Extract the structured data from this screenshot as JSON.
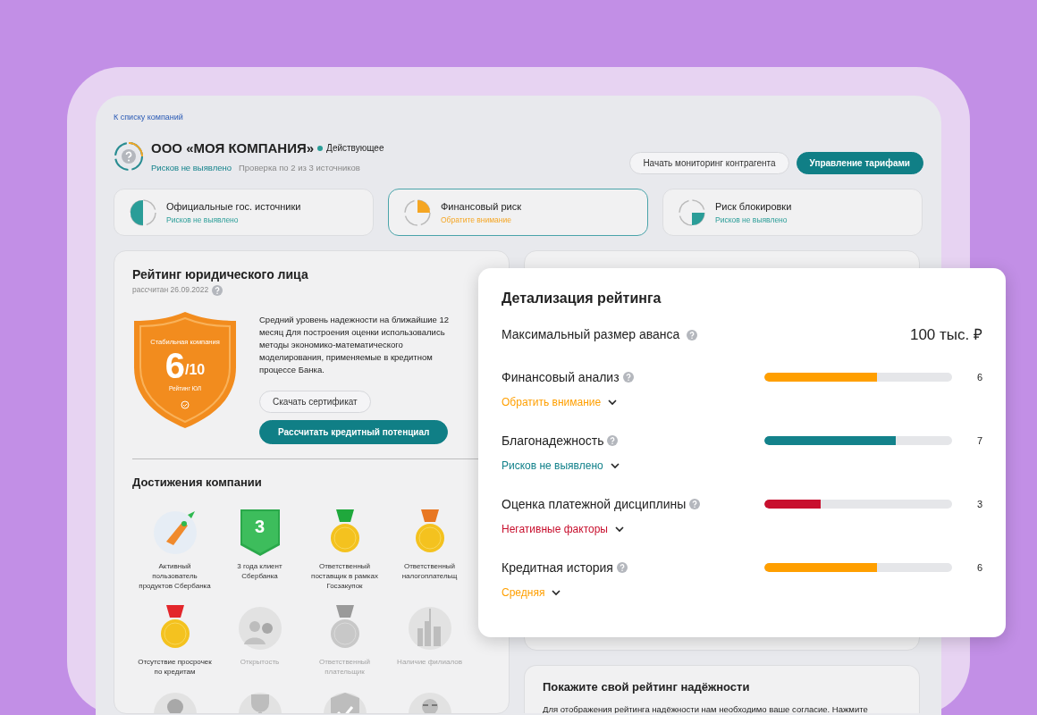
{
  "back_link": "К списку компаний",
  "company": {
    "name": "ООО «МОЯ КОМПАНИЯ»",
    "status": "Действующее",
    "risk_summary": "Рисков не выявлено",
    "check_info": "Проверка по 2 из 3 источников"
  },
  "header_buttons": [
    {
      "label": "Начать мониторинг контрагента",
      "kind": "outline"
    },
    {
      "label": "Управление тарифами",
      "kind": "primary"
    }
  ],
  "risk_cards": [
    {
      "title": "Официальные гос. источники",
      "status": "Рисков не выявлено",
      "kind": "half",
      "color": "#2a9d98",
      "selected": false
    },
    {
      "title": "Финансовый риск",
      "status": "Обратите внимание",
      "kind": "quarter-top",
      "color": "#f5a623",
      "selected": true
    },
    {
      "title": "Риск блокировки",
      "status": "Рисков не выявлено",
      "kind": "quarter-bottom",
      "color": "#2a9d98",
      "selected": false
    }
  ],
  "rating": {
    "title": "Рейтинг юридического лица",
    "date": "рассчитан 26.09.2022",
    "shield": {
      "label": "Стабильная компания",
      "score": "6",
      "scale": "/10",
      "caption": "Рейтинг ЮЛ"
    },
    "description": "Средний уровень надежности на ближайшие 12 месяц Для построения оценки использовались методы экономико-математического моделирования, применяемые в кредитном процессе Банка.",
    "buttons": [
      {
        "label": "Скачать сертификат",
        "kind": "outline"
      },
      {
        "label": "Рассчитать кредитный потенциал",
        "kind": "primary"
      }
    ]
  },
  "achievements": {
    "title": "Достижения компании",
    "items": [
      {
        "kind": "rocket",
        "label": "Активный пользователь продуктов Сбербанка",
        "earned": true
      },
      {
        "kind": "years",
        "badge_text": "3",
        "label": "3 года клиент Сбербанка",
        "earned": true
      },
      {
        "kind": "medal",
        "color": "#1fa83c",
        "label": "Ответственный поставщик в рамках Госзакупок",
        "earned": true
      },
      {
        "kind": "medal",
        "color": "#e87722",
        "label": "Ответственный налогоплательщ",
        "earned": true
      },
      {
        "kind": "medal",
        "color": "#e3262b",
        "label": "Отсутствие просрочек по кредитам",
        "earned": true
      },
      {
        "kind": "people",
        "label": "Открытость",
        "earned": false
      },
      {
        "kind": "medal",
        "color": "#9a9a9a",
        "label": "Ответственный плательщик",
        "earned": false
      },
      {
        "kind": "city",
        "label": "Наличие филиалов",
        "earned": false
      },
      {
        "kind": "person",
        "earned": false
      },
      {
        "kind": "trophy",
        "earned": false
      },
      {
        "kind": "shield",
        "earned": false
      },
      {
        "kind": "person-glasses",
        "earned": false
      }
    ]
  },
  "consent": {
    "title": "Покажите свой рейтинг надёжности",
    "text": "Для отображения рейтинга надёжности нам необходимо ваше согласие. Нажмите"
  },
  "detail": {
    "title": "Детализация рейтинга",
    "advance": {
      "label": "Максимальный размер аванса",
      "value": "100 тыс. ₽"
    },
    "factors": [
      {
        "label": "Финансовый анализ",
        "level": 0.6,
        "score": "6",
        "status": "Обратить внимание",
        "color": "#ff9f00"
      },
      {
        "label": "Благонадежность",
        "level": 0.7,
        "score": "7",
        "status": "Рисков не выявлено",
        "color": "#13828b"
      },
      {
        "label": "Оценка платежной дисциплины",
        "level": 0.3,
        "score": "3",
        "status": "Негативные факторы",
        "color": "#c8102e"
      },
      {
        "label": "Кредитная история",
        "level": 0.6,
        "score": "6",
        "status": "Средняя",
        "color": "#ff9f00"
      }
    ]
  }
}
